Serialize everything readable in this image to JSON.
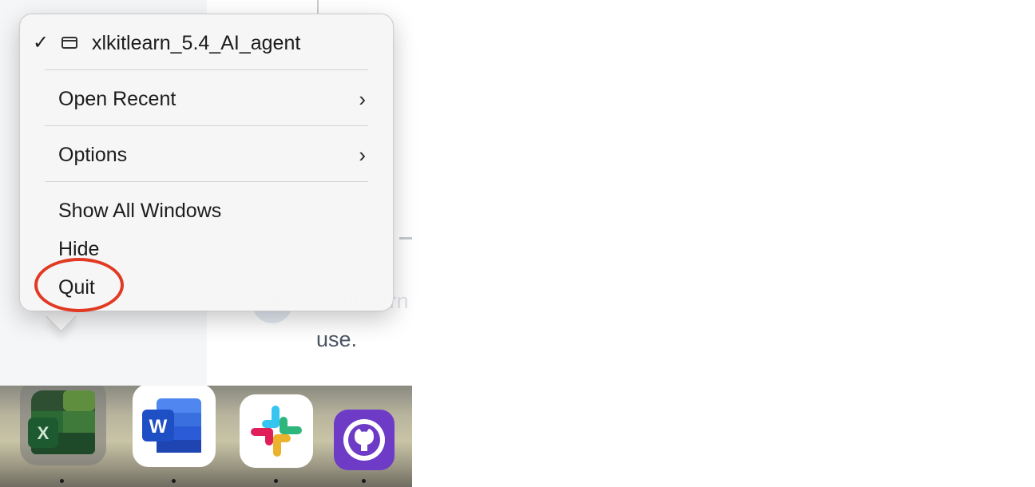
{
  "menu": {
    "window_item": {
      "label": "xlkitlearn_5.4_AI_agent",
      "checked": true,
      "icon": "window-icon"
    },
    "open_recent_label": "Open Recent",
    "options_label": "Options",
    "show_all_windows_label": "Show All Windows",
    "hide_label": "Hide",
    "quit_label": "Quit",
    "chevron_glyph": "›"
  },
  "background": {
    "partial_text": "xlkitLearn",
    "use_text": "use."
  },
  "dock": {
    "apps": [
      {
        "name": "Microsoft Excel",
        "icon": "excel-icon",
        "glyph": "X",
        "running": true
      },
      {
        "name": "Microsoft Word",
        "icon": "word-icon",
        "glyph": "W",
        "running": true
      },
      {
        "name": "Slack",
        "icon": "slack-icon",
        "running": true
      },
      {
        "name": "GitHub Desktop",
        "icon": "github-icon",
        "running": true
      }
    ]
  },
  "colors": {
    "annotation": "#e23a22",
    "excel_green": "#1f6b3a",
    "word_blue": "#2b5bd7",
    "github_purple": "#6e3bc7"
  }
}
